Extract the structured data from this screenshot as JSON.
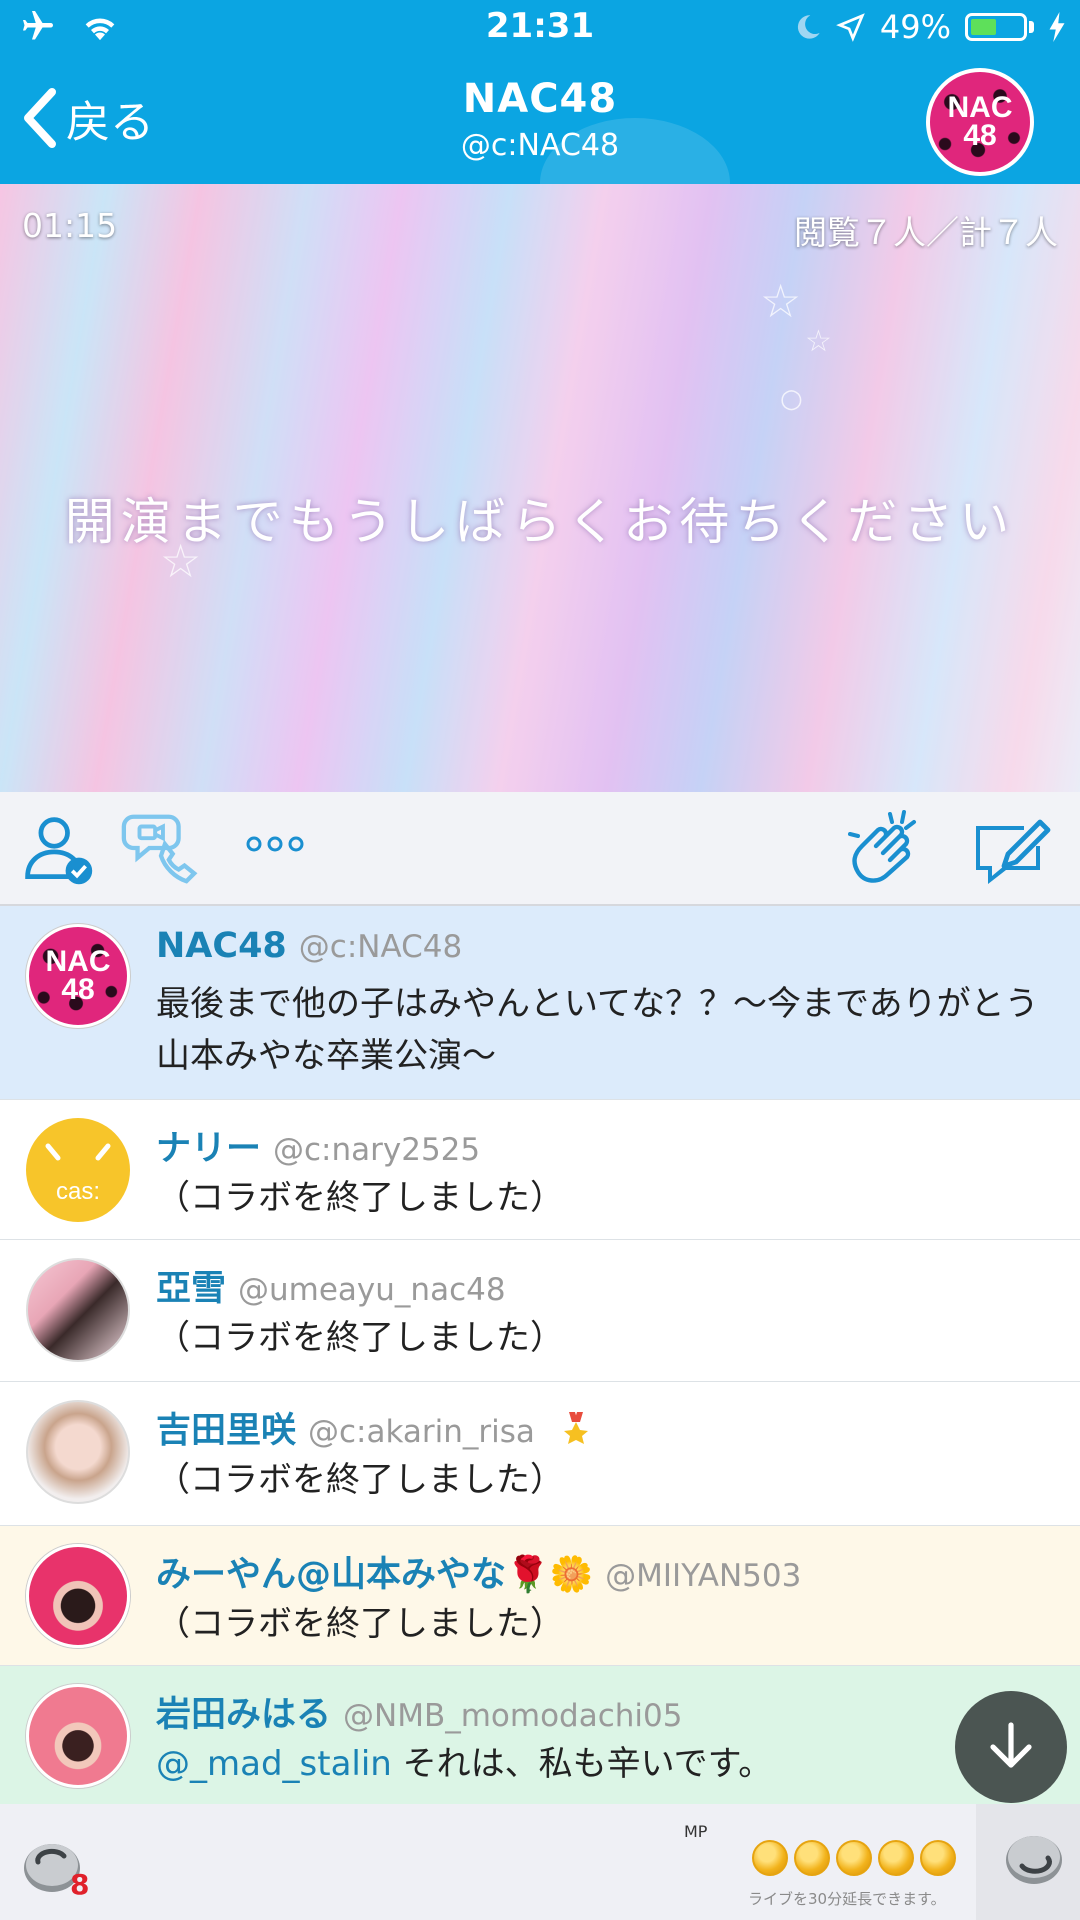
{
  "status_bar": {
    "time": "21:31",
    "battery_percent_label": "49%",
    "battery_level": 0.49,
    "icons": [
      "airplane-icon",
      "wifi-icon",
      "moon-icon",
      "location-arrow-icon",
      "battery-icon",
      "charging-bolt-icon"
    ]
  },
  "nav": {
    "back_label": "戻る",
    "title": "NAC48",
    "subtitle": "@c:NAC48",
    "avatar_text_line1": "NAC",
    "avatar_text_line2": "48"
  },
  "video": {
    "timer": "01:15",
    "viewers": "閲覧７人／計７人",
    "message": "開演までもうしばらくお待ちください"
  },
  "toolbar": {
    "icons": [
      "user-check-icon",
      "video-call-icon",
      "more-dots-icon",
      "clap-icon",
      "compose-icon"
    ]
  },
  "comments": [
    {
      "name": "NAC48",
      "handle": "@c:NAC48",
      "text": "最後まで他の子はみやんといてな？？〜今までありがとう山本みやな卒業公演〜",
      "bg": "#dcebfb"
    },
    {
      "name": "ナリー",
      "handle": "@c:nary2525",
      "text": "（コラボを終了しました）",
      "avatar_text": "cas:",
      "bg": "#ffffff"
    },
    {
      "name": "亞雪",
      "handle": "@umeayu_nac48",
      "text": "（コラボを終了しました）",
      "bg": "#ffffff"
    },
    {
      "name": "吉田里咲",
      "handle": "@c:akarin_risa",
      "text": "（コラボを終了しました）",
      "bg": "#ffffff"
    },
    {
      "name": "みーやん@山本みやな🌹🌼",
      "handle": "@MIIYAN503",
      "text": "（コラボを終了しました）",
      "bg": "#fef8e8"
    },
    {
      "name": "岩田みはる",
      "handle": "@NMB_momodachi05",
      "mention": "@_mad_stalin",
      "text": " それは、私も辛いです。",
      "bg": "#dcf5e6"
    }
  ],
  "bottom_bar": {
    "item_count": "8",
    "mp_label": "MP",
    "coins": 5,
    "extend_text": "ライブを30分延長できます。"
  },
  "colors": {
    "accent": "#0ba5e2",
    "link": "#1a82b5"
  }
}
